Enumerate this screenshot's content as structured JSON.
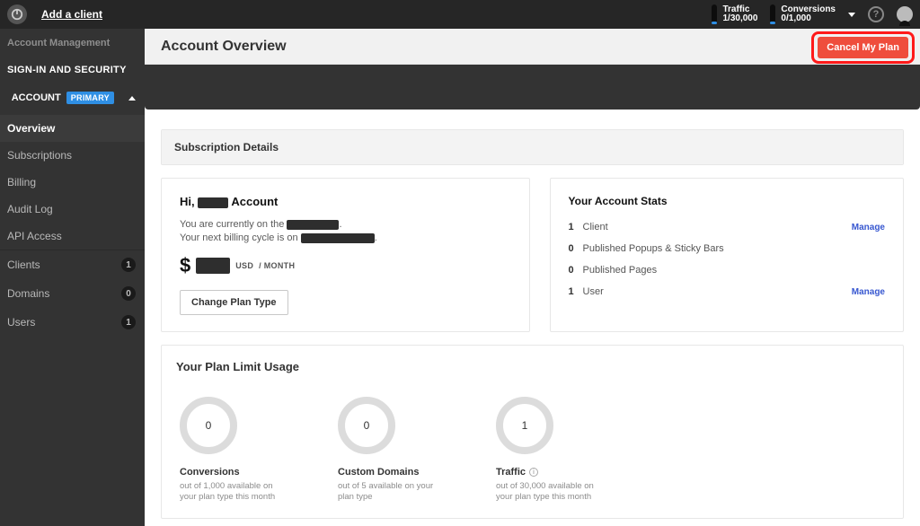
{
  "topbar": {
    "add_client": "Add a client",
    "traffic_label": "Traffic",
    "traffic_val": "1/30,000",
    "conversions_label": "Conversions",
    "conversions_val": "0/1,000"
  },
  "sidebar": {
    "accountMgmt": "Account Management",
    "signinSec": "SIGN-IN AND SECURITY",
    "account": "ACCOUNT",
    "primary": "PRIMARY",
    "items": [
      {
        "label": "Overview",
        "active": true
      },
      {
        "label": "Subscriptions"
      },
      {
        "label": "Billing"
      },
      {
        "label": "Audit Log"
      },
      {
        "label": "API Access"
      },
      {
        "label": "Clients",
        "count": "1"
      },
      {
        "label": "Domains",
        "count": "0"
      },
      {
        "label": "Users",
        "count": "1"
      }
    ]
  },
  "header": {
    "title": "Account Overview",
    "cancel": "Cancel My Plan"
  },
  "subscription": {
    "panel_title": "Subscription Details",
    "hi_prefix": "Hi, ",
    "hi_suffix": " Account",
    "line1_pre": "You are currently on the ",
    "line1_post": ".",
    "line2_pre": "Your next billing cycle is on ",
    "line2_post": ".",
    "usd": "USD",
    "slash_month": "/ MONTH",
    "change_plan": "Change Plan Type"
  },
  "stats": {
    "title": "Your Account Stats",
    "rows": [
      {
        "n": "1",
        "label": "Client",
        "manage": true
      },
      {
        "n": "0",
        "label": "Published Popups & Sticky Bars"
      },
      {
        "n": "0",
        "label": "Published Pages"
      },
      {
        "n": "1",
        "label": "User",
        "manage": true
      }
    ],
    "manage": "Manage"
  },
  "usage": {
    "title": "Your Plan Limit Usage",
    "gauges": [
      {
        "value": "0",
        "label": "Conversions",
        "sub": "out of 1,000 available on your plan type this month"
      },
      {
        "value": "0",
        "label": "Custom Domains",
        "sub": "out of 5 available on your plan type"
      },
      {
        "value": "1",
        "label": "Traffic",
        "sub": "out of 30,000 available on your plan type this month",
        "info": true
      }
    ]
  }
}
